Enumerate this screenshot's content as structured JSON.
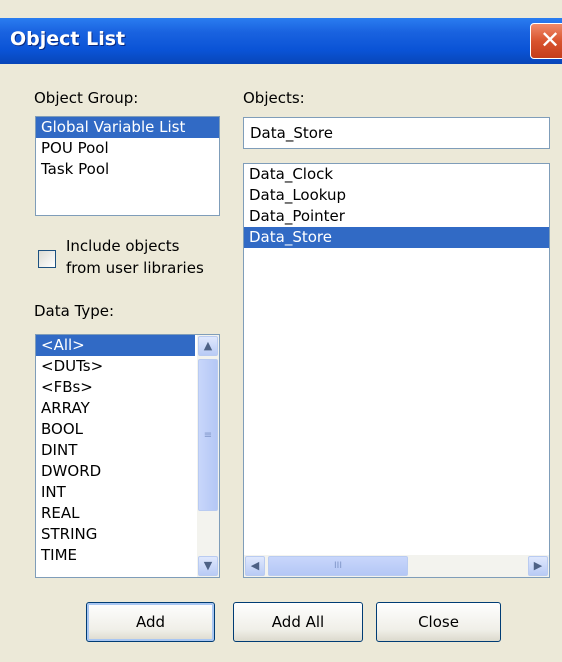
{
  "window": {
    "title": "Object List",
    "close_glyph": "✕"
  },
  "object_group": {
    "label": "Object Group:",
    "items": [
      "Global Variable List",
      "POU Pool",
      "Task Pool"
    ],
    "selected_index": 0
  },
  "include_libraries": {
    "label_line1": "Include objects",
    "label_line2": "from user libraries",
    "checked": false
  },
  "data_type": {
    "label": "Data Type:",
    "items": [
      "<All>",
      "<DUTs>",
      "<FBs>",
      "ARRAY",
      "BOOL",
      "DINT",
      "DWORD",
      "INT",
      "REAL",
      "STRING",
      "TIME"
    ],
    "selected_index": 0
  },
  "objects": {
    "label": "Objects:",
    "field_value": "Data_Store",
    "items": [
      "Data_Clock",
      "Data_Lookup",
      "Data_Pointer",
      "Data_Store"
    ],
    "selected_index": 3
  },
  "buttons": {
    "add": "Add",
    "add_all": "Add All",
    "close": "Close"
  },
  "icons": {
    "scroll_up": "▲",
    "scroll_down": "▼",
    "scroll_left": "◀",
    "scroll_right": "▶",
    "grip_v": "≡",
    "grip_h": "III"
  },
  "colors": {
    "titlebar": "#0a53d6",
    "selection": "#316ac5",
    "dialog_bg": "#ece9d8"
  }
}
